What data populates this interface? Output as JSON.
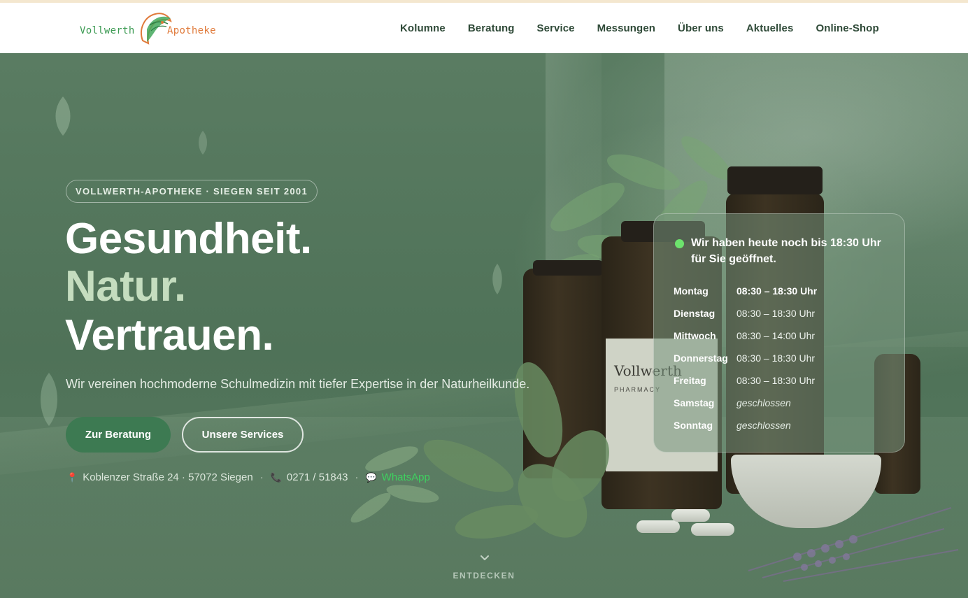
{
  "header": {
    "logo": {
      "left_word": "Vollwerth",
      "right_word": "Apotheke"
    },
    "nav": [
      {
        "label": "Kolumne"
      },
      {
        "label": "Beratung"
      },
      {
        "label": "Service"
      },
      {
        "label": "Messungen"
      },
      {
        "label": "Über uns"
      },
      {
        "label": "Aktuelles"
      },
      {
        "label": "Online-Shop"
      }
    ]
  },
  "hero": {
    "badge": "VOLLWERTH-APOTHEKE · SIEGEN SEIT 2001",
    "headline": {
      "line1": "Gesundheit.",
      "line2": "Natur.",
      "line3": "Vertrauen."
    },
    "subline": "Wir vereinen hochmoderne Schulmedizin mit tiefer Expertise in der Naturheilkunde.",
    "buttons": {
      "primary": "Zur Beratung",
      "secondary": "Unsere Services"
    },
    "contact": {
      "address_icon": "pin-icon",
      "address": "Koblenzer Straße 24 · 57072 Siegen",
      "separator": "·",
      "phone_icon": "phone-icon",
      "phone": "0271 / 51843",
      "whatsapp_icon": "chat-bubble-icon",
      "whatsapp": "WhatsApp"
    },
    "bottle_label": {
      "title": "Vollwerth",
      "subtitle": "PHARMACY"
    },
    "scroll_hint": "ENTDECKEN"
  },
  "hours": {
    "status": "Wir haben heute noch bis 18:30 Uhr für Sie geöffnet.",
    "rows": [
      {
        "day": "Montag",
        "time": "08:30 – 18:30 Uhr"
      },
      {
        "day": "Dienstag",
        "time": "08:30 – 18:30 Uhr"
      },
      {
        "day": "Mittwoch",
        "time": "08:30 – 14:00 Uhr"
      },
      {
        "day": "Donnerstag",
        "time": "08:30 – 18:30 Uhr"
      },
      {
        "day": "Freitag",
        "time": "08:30 – 18:30 Uhr"
      },
      {
        "day": "Samstag",
        "time": "geschlossen"
      },
      {
        "day": "Sonntag",
        "time": "geschlossen"
      }
    ]
  },
  "colors": {
    "nav_text": "#2f4a38",
    "primary_button": "#3d7a52",
    "headline_accent": "#c5ddbf",
    "open_status": "#6de36d",
    "whatsapp": "#3ed15f"
  }
}
